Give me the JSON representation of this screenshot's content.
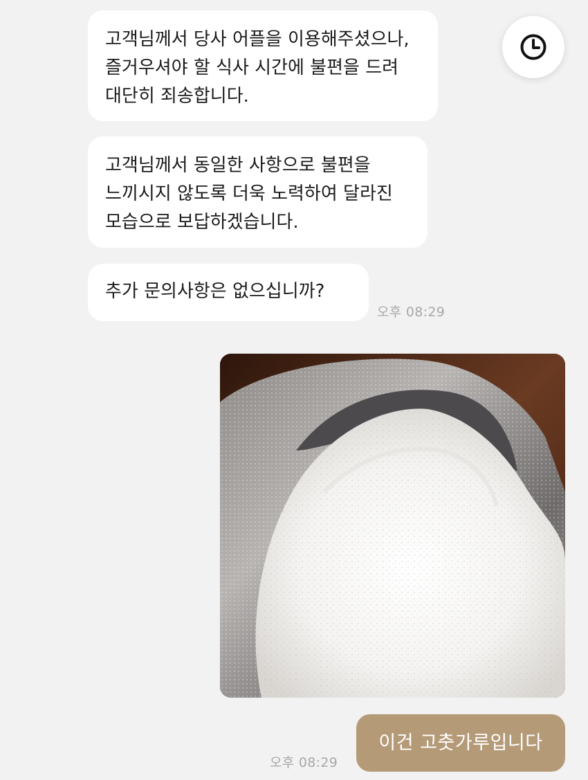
{
  "chat": {
    "messages": {
      "agent_1": "고객님께서 당사 어플을 이용해주셨으나, 즐거우셔야 할 식사 시간에 불편을 드려 대단히 죄송합니다.",
      "agent_2": "고객님께서 동일한 사항으로 불편을 느끼시지 않도록 더욱 노력하여 달라진 모습으로 보답하겠습니다.",
      "agent_3": "추가 문의사항은 없으십니까?",
      "agent_time": "오후 08:29",
      "user_reply": "이건 고춧가루입니다",
      "user_time": "오후 08:29"
    },
    "icons": {
      "history": "clock-icon",
      "attachment": "flour-sack-photo"
    },
    "colors": {
      "background": "#f2f2f2",
      "incoming_bubble": "#ffffff",
      "outgoing_bubble": "#b59a78",
      "timestamp": "#a8a8a8"
    }
  }
}
